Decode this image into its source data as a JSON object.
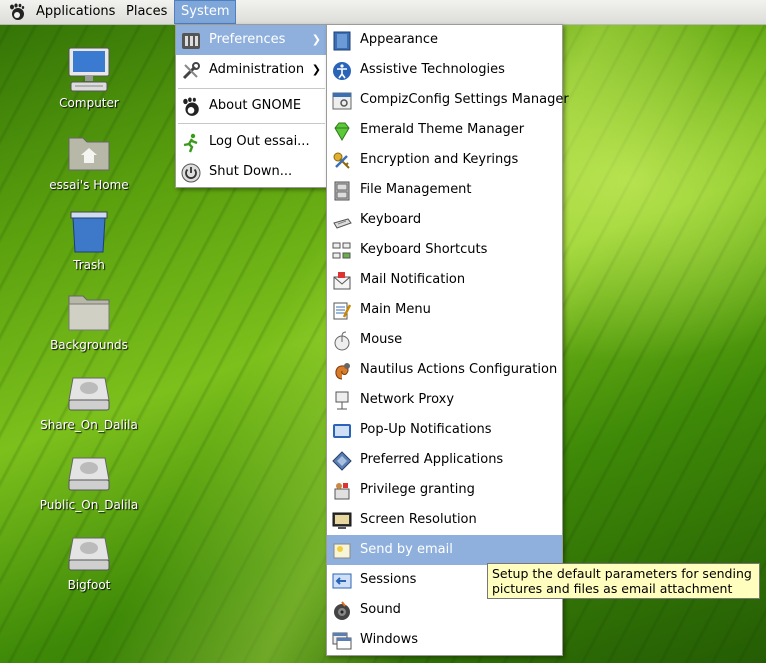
{
  "panel": {
    "menus": [
      "Applications",
      "Places",
      "System"
    ],
    "foot_icon": "gnome-foot-icon"
  },
  "desktop_icons": [
    {
      "label": "Computer",
      "icon": "computer-icon"
    },
    {
      "label": "essai's Home",
      "icon": "home-folder-icon"
    },
    {
      "label": "Trash",
      "icon": "trash-icon"
    },
    {
      "label": "Backgrounds",
      "icon": "folder-icon"
    },
    {
      "label": "Share_On_Dalila",
      "icon": "drive-icon"
    },
    {
      "label": "Public_On_Dalila",
      "icon": "drive-icon"
    },
    {
      "label": "Bigfoot",
      "icon": "drive-icon"
    }
  ],
  "system_menu": [
    {
      "label": "Preferences",
      "icon": "preferences-icon",
      "submenu": true
    },
    {
      "label": "Administration",
      "icon": "administration-icon",
      "submenu": true
    },
    {
      "label": "About GNOME",
      "icon": "gnome-foot-icon"
    },
    {
      "label": "Log Out essai...",
      "icon": "logout-icon"
    },
    {
      "label": "Shut Down...",
      "icon": "power-icon"
    }
  ],
  "preferences_menu": [
    "Appearance",
    "Assistive Technologies",
    "CompizConfig Settings Manager",
    "Emerald Theme Manager",
    "Encryption and Keyrings",
    "File Management",
    "Keyboard",
    "Keyboard Shortcuts",
    "Mail Notification",
    "Main Menu",
    "Mouse",
    "Nautilus Actions Configuration",
    "Network Proxy",
    "Pop-Up Notifications",
    "Preferred Applications",
    "Privilege granting",
    "Screen Resolution",
    "Send by email",
    "Sessions",
    "Sound",
    "Windows"
  ],
  "selected_preference": "Send by email",
  "tooltip": "Setup the default parameters for sending pictures and files as email attachment",
  "colors": {
    "selection": "#8fb0dc",
    "tooltip_bg": "#fffebe"
  }
}
